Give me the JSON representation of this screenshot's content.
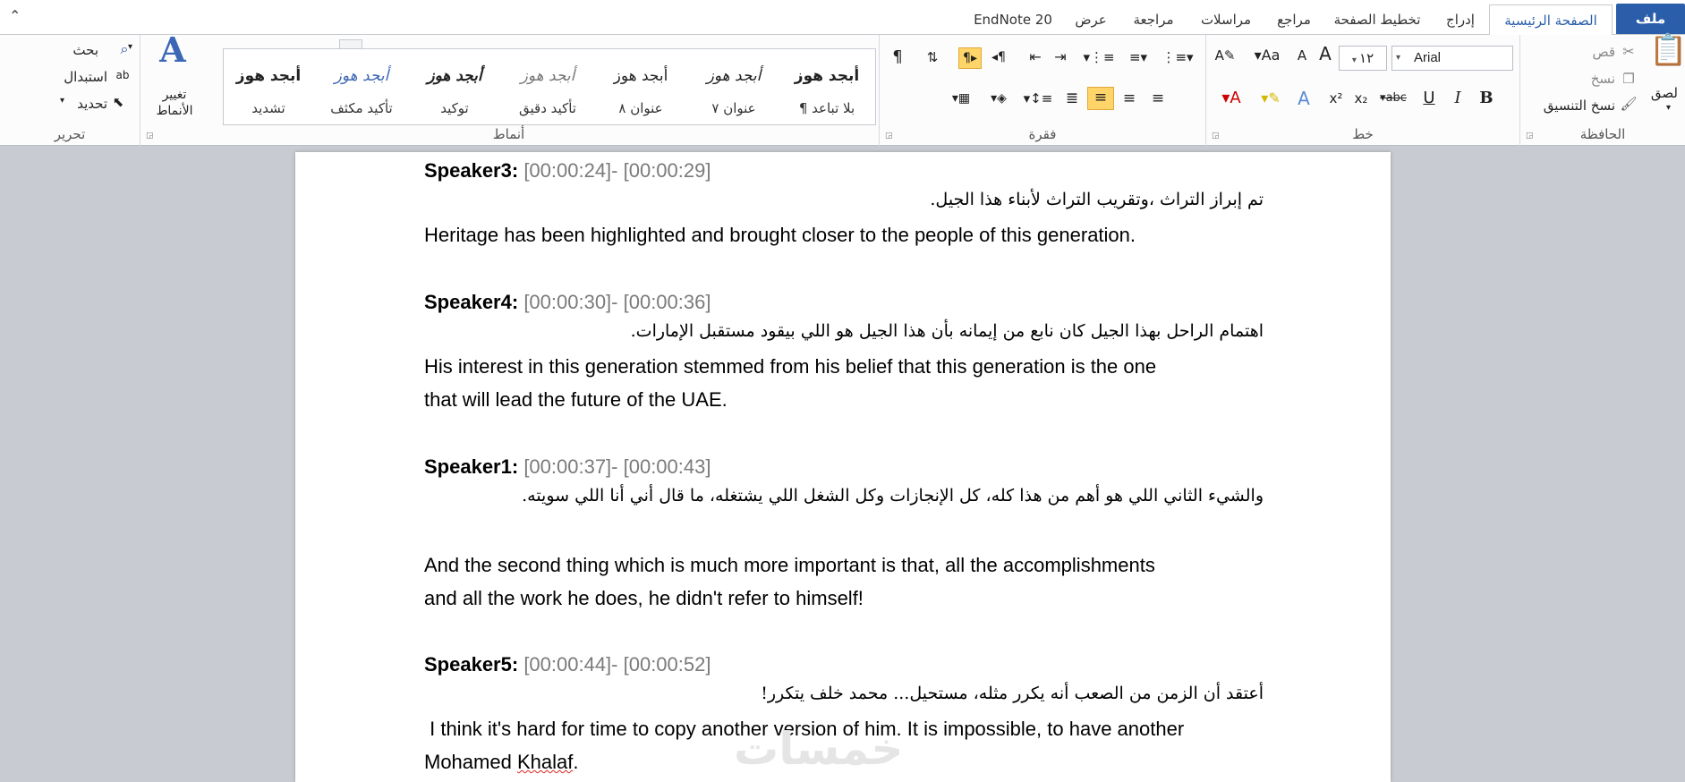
{
  "tabs": {
    "file": "ملف",
    "home": "الصفحة الرئيسية",
    "insert": "إدراج",
    "layout": "تخطيط الصفحة",
    "references": "مراجع",
    "mailings": "مراسلات",
    "review": "مراجعة",
    "view": "عرض",
    "endnote": "EndNote 20"
  },
  "clipboard": {
    "paste": "لصق",
    "cut": "قص",
    "copy": "نسخ",
    "format_painter": "نسخ التنسيق",
    "label": "الحافظة"
  },
  "font": {
    "name": "Arial",
    "size": "١٢",
    "label": "خط",
    "bold": "B",
    "italic": "I",
    "underline": "U",
    "strike": "abc"
  },
  "paragraph": {
    "label": "فقرة",
    "pilcrow": "¶"
  },
  "styles": {
    "label": "أنماط",
    "change": "تغيير الأنماط",
    "items": [
      {
        "preview": "أبجد هوز",
        "name": "¶ بلا تباعد"
      },
      {
        "preview": "أبجد هوز",
        "name": "عنوان ٧"
      },
      {
        "preview": "أبجد هوز",
        "name": "عنوان ٨"
      },
      {
        "preview": "أبجد هوز",
        "name": "تأكيد دقيق"
      },
      {
        "preview": "أبجد هوز",
        "name": "توكيد"
      },
      {
        "preview": "أبجد هوز",
        "name": "تأكيد مكثف"
      },
      {
        "preview": "أبجد هوز",
        "name": "تشديد"
      }
    ]
  },
  "editing": {
    "label": "تحرير",
    "find": "بحث",
    "replace": "استبدال",
    "select": "تحديد"
  },
  "document": {
    "s3": {
      "speaker": "Speaker3:",
      "time": "[00:00:24]-  [00:00:29]",
      "arabic": "تم إبراز التراث ،وتقريب التراث لأبناء هذا الجيل.",
      "english": "Heritage has been highlighted and brought closer to the people of this generation."
    },
    "s4": {
      "speaker": "Speaker4:",
      "time": "[00:00:30]- [00:00:36]",
      "arabic": "اهتمام الراحل بهذا الجيل كان نابع من إيمانه بأن هذا الجيل هو اللي بيقود مستقبل الإمارات.",
      "english1": "His interest in this generation stemmed from his belief that this generation is the one",
      "english2": "that will lead the future of the UAE."
    },
    "s1": {
      "speaker": "Speaker1:",
      "time": "[00:00:37]- [00:00:43]",
      "arabic": "والشيء الثاني اللي هو أهم من هذا كله، كل الإنجازات وكل الشغل اللي يشتغله، ما قال أني أنا اللي سويته.",
      "english1": "And the second thing which is much more important is that, all the accomplishments",
      "english2": "and all the work he does, he didn't refer to himself!"
    },
    "s5": {
      "speaker": "Speaker5:",
      "time": "[00:00:44]- [00:00:52]",
      "arabic": "أعتقد أن الزمن من الصعب أنه يكرر مثله، مستحيل... محمد خلف يتكرر!",
      "english1": " I think it's hard for time to copy another version of him. It is impossible, to have another",
      "english2a": "Mohamed ",
      "english2b": "Khalaf",
      "english2c": "."
    }
  },
  "watermark": "خمسات"
}
